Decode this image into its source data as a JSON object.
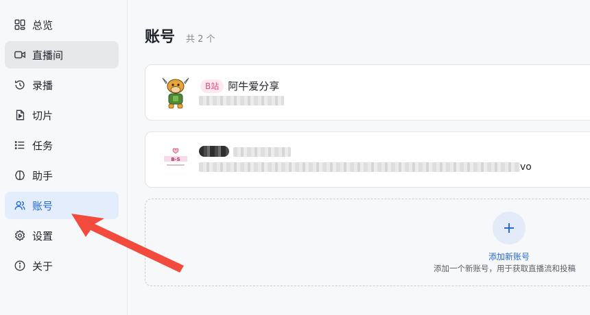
{
  "sidebar": {
    "items": [
      {
        "label": "总览",
        "icon": "grid-icon"
      },
      {
        "label": "直播间",
        "icon": "video-icon"
      },
      {
        "label": "录播",
        "icon": "history-icon"
      },
      {
        "label": "切片",
        "icon": "clip-file-icon"
      },
      {
        "label": "任务",
        "icon": "list-icon"
      },
      {
        "label": "助手",
        "icon": "brain-icon"
      },
      {
        "label": "账号",
        "icon": "users-icon"
      },
      {
        "label": "设置",
        "icon": "gear-icon"
      },
      {
        "label": "关于",
        "icon": "info-icon"
      }
    ]
  },
  "main": {
    "title": "账号",
    "count": "共 2 个",
    "accounts": [
      {
        "platform": "B站",
        "name": "阿牛爱分享",
        "uid": ""
      },
      {
        "platform": "",
        "name": "",
        "uid": "",
        "uid_tail": "vo"
      }
    ],
    "add": {
      "title": "添加新账号",
      "subtitle": "添加一个新账号，用于获取直播流和投稿"
    }
  },
  "colors": {
    "accent": "#2468d8",
    "bilibili_pink": "#e04f7d",
    "arrow_red": "#f24a3d"
  }
}
